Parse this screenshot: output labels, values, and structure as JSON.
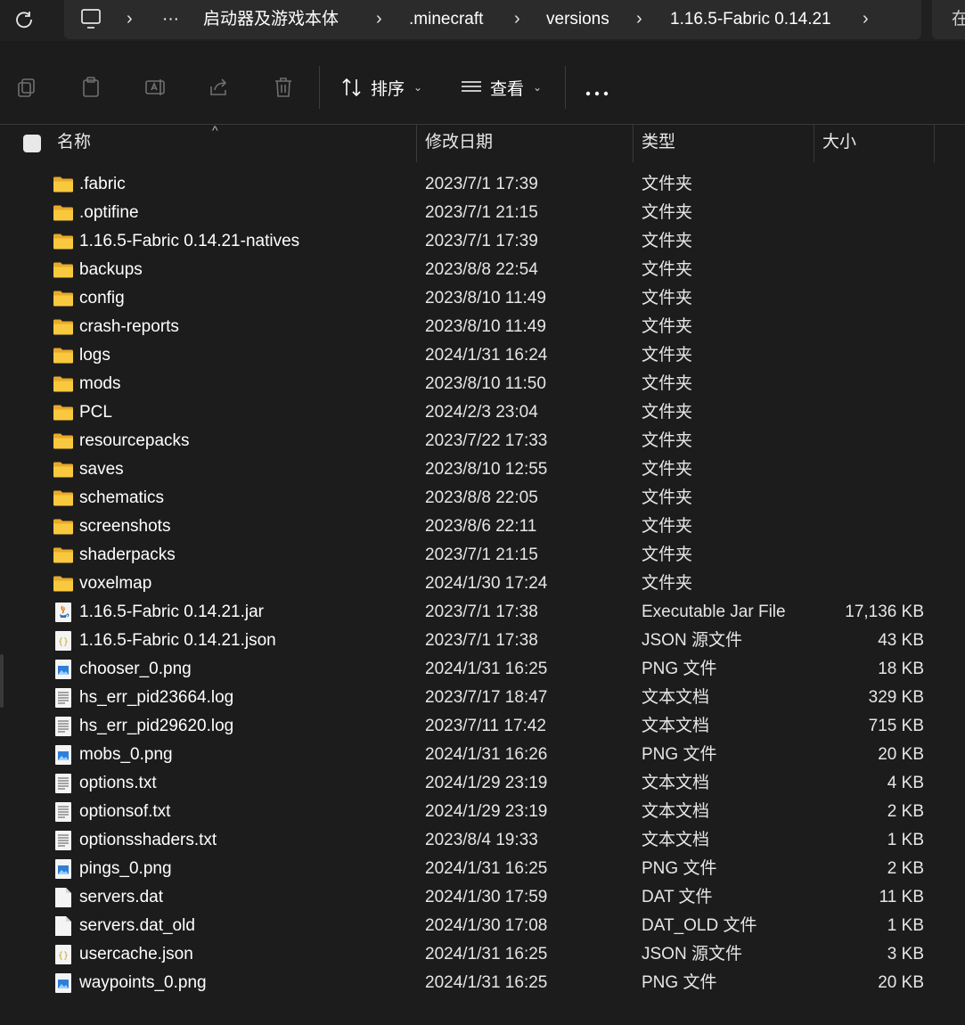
{
  "breadcrumb": {
    "items": [
      "启动器及游戏本体",
      ".minecraft",
      "versions",
      "1.16.5-Fabric 0.14.21"
    ],
    "more": "···",
    "search_stub": "在"
  },
  "toolbar": {
    "sort_label": "排序",
    "view_label": "查看"
  },
  "columns": {
    "name": "名称",
    "date": "修改日期",
    "type": "类型",
    "size": "大小"
  },
  "files": [
    {
      "name": ".fabric",
      "date": "2023/7/1 17:39",
      "type": "文件夹",
      "size": "",
      "icon": "folder-icon"
    },
    {
      "name": ".optifine",
      "date": "2023/7/1 21:15",
      "type": "文件夹",
      "size": "",
      "icon": "folder-icon"
    },
    {
      "name": "1.16.5-Fabric 0.14.21-natives",
      "date": "2023/7/1 17:39",
      "type": "文件夹",
      "size": "",
      "icon": "folder-icon"
    },
    {
      "name": "backups",
      "date": "2023/8/8 22:54",
      "type": "文件夹",
      "size": "",
      "icon": "folder-icon"
    },
    {
      "name": "config",
      "date": "2023/8/10 11:49",
      "type": "文件夹",
      "size": "",
      "icon": "folder-icon"
    },
    {
      "name": "crash-reports",
      "date": "2023/8/10 11:49",
      "type": "文件夹",
      "size": "",
      "icon": "folder-icon"
    },
    {
      "name": "logs",
      "date": "2024/1/31 16:24",
      "type": "文件夹",
      "size": "",
      "icon": "folder-icon"
    },
    {
      "name": "mods",
      "date": "2023/8/10 11:50",
      "type": "文件夹",
      "size": "",
      "icon": "folder-icon"
    },
    {
      "name": "PCL",
      "date": "2024/2/3 23:04",
      "type": "文件夹",
      "size": "",
      "icon": "folder-icon"
    },
    {
      "name": "resourcepacks",
      "date": "2023/7/22 17:33",
      "type": "文件夹",
      "size": "",
      "icon": "folder-icon"
    },
    {
      "name": "saves",
      "date": "2023/8/10 12:55",
      "type": "文件夹",
      "size": "",
      "icon": "folder-icon"
    },
    {
      "name": "schematics",
      "date": "2023/8/8 22:05",
      "type": "文件夹",
      "size": "",
      "icon": "folder-icon"
    },
    {
      "name": "screenshots",
      "date": "2023/8/6 22:11",
      "type": "文件夹",
      "size": "",
      "icon": "folder-icon"
    },
    {
      "name": "shaderpacks",
      "date": "2023/7/1 21:15",
      "type": "文件夹",
      "size": "",
      "icon": "folder-icon"
    },
    {
      "name": "voxelmap",
      "date": "2024/1/30 17:24",
      "type": "文件夹",
      "size": "",
      "icon": "folder-icon"
    },
    {
      "name": "1.16.5-Fabric 0.14.21.jar",
      "date": "2023/7/1 17:38",
      "type": "Executable Jar File",
      "size": "17,136 KB",
      "icon": "java-jar-icon"
    },
    {
      "name": "1.16.5-Fabric 0.14.21.json",
      "date": "2023/7/1 17:38",
      "type": "JSON 源文件",
      "size": "43 KB",
      "icon": "json-file-icon"
    },
    {
      "name": "chooser_0.png",
      "date": "2024/1/31 16:25",
      "type": "PNG 文件",
      "size": "18 KB",
      "icon": "image-file-icon"
    },
    {
      "name": "hs_err_pid23664.log",
      "date": "2023/7/17 18:47",
      "type": "文本文档",
      "size": "329 KB",
      "icon": "text-file-icon"
    },
    {
      "name": "hs_err_pid29620.log",
      "date": "2023/7/11 17:42",
      "type": "文本文档",
      "size": "715 KB",
      "icon": "text-file-icon"
    },
    {
      "name": "mobs_0.png",
      "date": "2024/1/31 16:26",
      "type": "PNG 文件",
      "size": "20 KB",
      "icon": "image-file-icon"
    },
    {
      "name": "options.txt",
      "date": "2024/1/29 23:19",
      "type": "文本文档",
      "size": "4 KB",
      "icon": "text-file-icon"
    },
    {
      "name": "optionsof.txt",
      "date": "2024/1/29 23:19",
      "type": "文本文档",
      "size": "2 KB",
      "icon": "text-file-icon"
    },
    {
      "name": "optionsshaders.txt",
      "date": "2023/8/4 19:33",
      "type": "文本文档",
      "size": "1 KB",
      "icon": "text-file-icon"
    },
    {
      "name": "pings_0.png",
      "date": "2024/1/31 16:25",
      "type": "PNG 文件",
      "size": "2 KB",
      "icon": "image-file-icon"
    },
    {
      "name": "servers.dat",
      "date": "2024/1/30 17:59",
      "type": "DAT 文件",
      "size": "11 KB",
      "icon": "blank-file-icon"
    },
    {
      "name": "servers.dat_old",
      "date": "2024/1/30 17:08",
      "type": "DAT_OLD 文件",
      "size": "1 KB",
      "icon": "blank-file-icon"
    },
    {
      "name": "usercache.json",
      "date": "2024/1/31 16:25",
      "type": "JSON 源文件",
      "size": "3 KB",
      "icon": "json-file-icon"
    },
    {
      "name": "waypoints_0.png",
      "date": "2024/1/31 16:25",
      "type": "PNG 文件",
      "size": "20 KB",
      "icon": "image-file-icon"
    }
  ],
  "colors": {
    "background": "#1c1c1c",
    "folder": "#f4c542",
    "text": "#ffffff"
  }
}
